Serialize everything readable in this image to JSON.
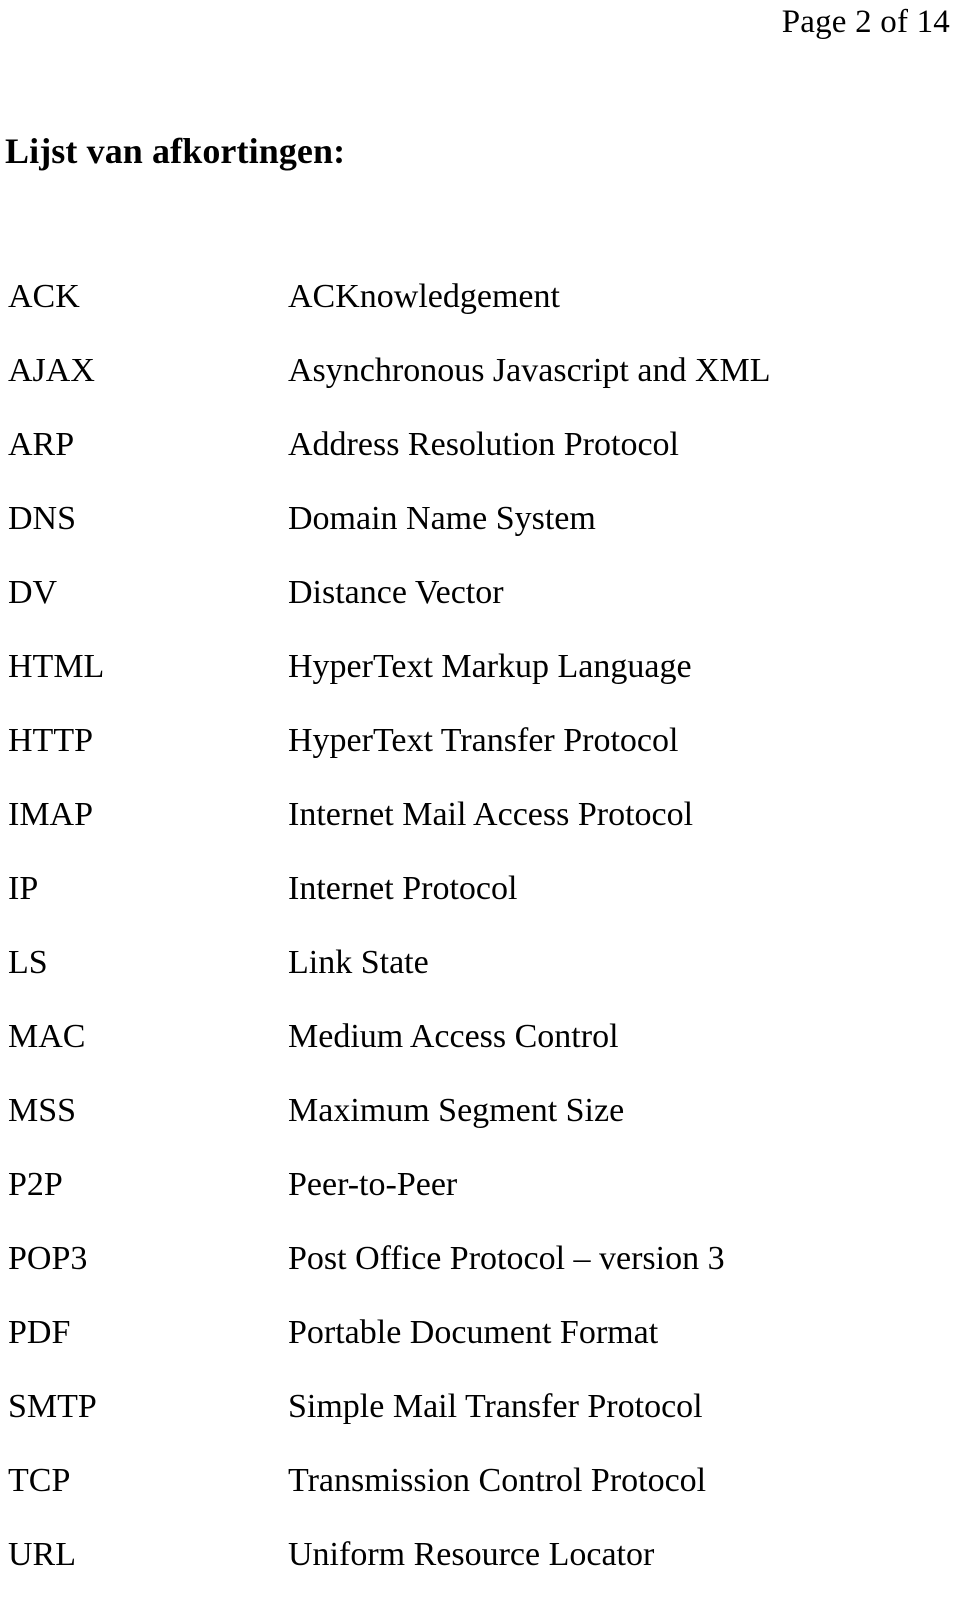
{
  "header": {
    "page_label": "Page 2 of 14"
  },
  "title": "Lijst van afkortingen:",
  "abbreviations": [
    {
      "term": "ACK",
      "definition": "ACKnowledgement"
    },
    {
      "term": "AJAX",
      "definition": "Asynchronous Javascript and XML"
    },
    {
      "term": "ARP",
      "definition": "Address Resolution Protocol"
    },
    {
      "term": "DNS",
      "definition": "Domain Name System"
    },
    {
      "term": "DV",
      "definition": "Distance Vector"
    },
    {
      "term": "HTML",
      "definition": "HyperText Markup Language"
    },
    {
      "term": "HTTP",
      "definition": "HyperText Transfer Protocol"
    },
    {
      "term": "IMAP",
      "definition": "Internet Mail Access Protocol"
    },
    {
      "term": "IP",
      "definition": "Internet Protocol"
    },
    {
      "term": "LS",
      "definition": "Link State"
    },
    {
      "term": "MAC",
      "definition": "Medium Access Control"
    },
    {
      "term": "MSS",
      "definition": "Maximum Segment Size"
    },
    {
      "term": "P2P",
      "definition": "Peer-to-Peer"
    },
    {
      "term": "POP3",
      "definition": "Post Office Protocol – version 3"
    },
    {
      "term": "PDF",
      "definition": "Portable Document Format"
    },
    {
      "term": "SMTP",
      "definition": "Simple Mail Transfer Protocol"
    },
    {
      "term": "TCP",
      "definition": "Transmission Control Protocol"
    },
    {
      "term": "URL",
      "definition": "Uniform Resource Locator"
    }
  ],
  "colors": {
    "page_background": "#ffffff",
    "text": "#000000"
  }
}
